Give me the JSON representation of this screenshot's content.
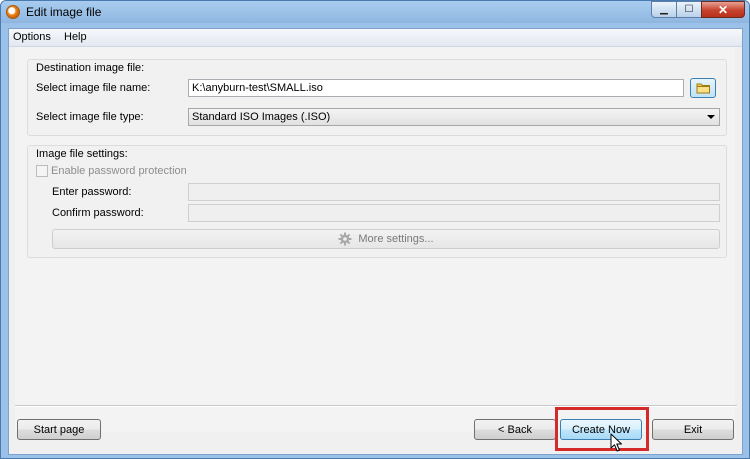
{
  "window": {
    "title": "Edit image file",
    "minimize_glyph": "▁",
    "maximize_glyph": "☐",
    "close_glyph": "✕"
  },
  "menu": {
    "items": [
      "Options",
      "Help"
    ]
  },
  "destination": {
    "group_label": "Destination image file:",
    "file_name_label": "Select image file name:",
    "file_name_value": "K:\\anyburn-test\\SMALL.iso",
    "file_type_label": "Select image file type:",
    "file_type_value": "Standard ISO Images (.ISO)"
  },
  "settings": {
    "group_label": "Image file settings:",
    "enable_password_label": "Enable password protection",
    "enable_password_checked": false,
    "enter_password_label": "Enter password:",
    "confirm_password_label": "Confirm password:",
    "more_settings_label": "More settings..."
  },
  "buttons": {
    "start_page": "Start page",
    "back": "< Back",
    "create_now": "Create Now",
    "exit": "Exit"
  },
  "icons": {
    "app": "anyburn-app-icon",
    "folder": "folder-icon",
    "gear": "gear-icon",
    "cursor": "mouse-pointer-icon"
  },
  "colors": {
    "highlight": "#d42a2a",
    "close_button": "#c7432e"
  }
}
